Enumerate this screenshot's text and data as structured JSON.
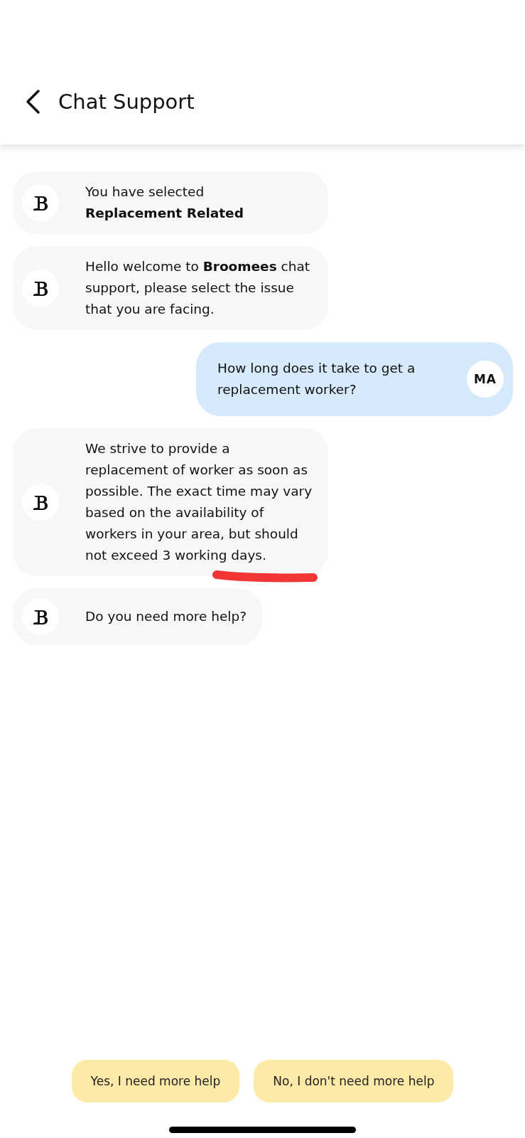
{
  "header": {
    "title": "Chat Support"
  },
  "messages": [
    {
      "kind": "bot",
      "text": "You have selected\n**Replacement Related**"
    },
    {
      "kind": "bot",
      "text": "Hello welcome to **Broomees** chat support, please select the issue that you are facing."
    },
    {
      "kind": "user",
      "text": "How long does it take to get a replacement worker?",
      "avatar": "MA"
    },
    {
      "kind": "bot",
      "text": "We strive to provide a replacement of worker as soon as possible. The exact time may vary based on the availability of workers in your area, but should not exceed 3 working days.",
      "annotated": true
    },
    {
      "kind": "bot",
      "text": "Do you need more help?"
    }
  ],
  "quick_replies": [
    "Yes, I need more help",
    "No, I don't need more help"
  ]
}
